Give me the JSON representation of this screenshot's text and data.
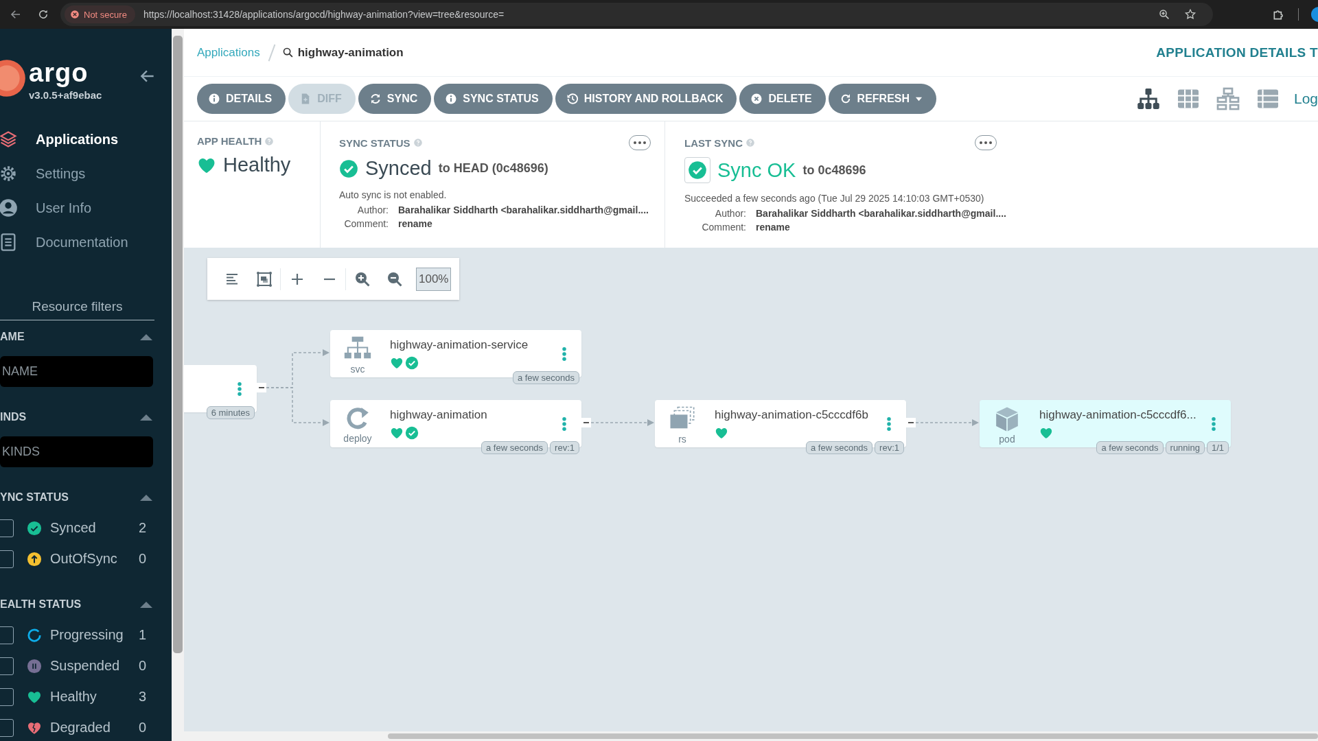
{
  "browser": {
    "security": "Not secure",
    "url": "https://localhost:31428/applications/argocd/highway-animation?view=tree&resource="
  },
  "sidebar": {
    "logo": "argo",
    "version": "v3.0.5+af9ebac",
    "nav": [
      {
        "label": "Applications",
        "kind": "layers",
        "selected": true
      },
      {
        "label": "Settings",
        "kind": "gear",
        "selected": false
      },
      {
        "label": "User Info",
        "kind": "user",
        "selected": false
      },
      {
        "label": "Documentation",
        "kind": "doc",
        "selected": false
      }
    ],
    "filters_title": "Resource filters",
    "filters": [
      {
        "kind": "input",
        "title": "AME",
        "placeholder": "NAME"
      },
      {
        "kind": "input",
        "title": "INDS",
        "placeholder": "KINDS"
      },
      {
        "kind": "checklist",
        "title": "YNC STATUS",
        "items": [
          {
            "label": "Synced",
            "count": "2",
            "kind": "synced",
            "checked": false
          },
          {
            "label": "OutOfSync",
            "count": "0",
            "kind": "outofsync",
            "checked": false
          }
        ]
      },
      {
        "kind": "checklist",
        "title": "EALTH STATUS",
        "items": [
          {
            "label": "Progressing",
            "count": "1",
            "kind": "progressing",
            "checked": false
          },
          {
            "label": "Suspended",
            "count": "0",
            "kind": "suspended",
            "checked": false
          },
          {
            "label": "Healthy",
            "count": "3",
            "kind": "healthy",
            "checked": false
          },
          {
            "label": "Degraded",
            "count": "0",
            "kind": "degraded",
            "checked": false
          }
        ]
      }
    ]
  },
  "breadcrumb": {
    "parent": "Applications",
    "current": "highway-animation"
  },
  "page_title": "APPLICATION DETAILS T",
  "actions": [
    {
      "label": "DETAILS",
      "kind": "info",
      "disabled": false,
      "dropdown": false
    },
    {
      "label": "DIFF",
      "kind": "file",
      "disabled": true,
      "dropdown": false
    },
    {
      "label": "SYNC",
      "kind": "sync",
      "disabled": false,
      "dropdown": false
    },
    {
      "label": "SYNC STATUS",
      "kind": "info",
      "disabled": false,
      "dropdown": false
    },
    {
      "label": "HISTORY AND ROLLBACK",
      "kind": "history",
      "disabled": false,
      "dropdown": false
    },
    {
      "label": "DELETE",
      "kind": "cancel",
      "disabled": false,
      "dropdown": false
    },
    {
      "label": "REFRESH",
      "kind": "refresh",
      "disabled": false,
      "dropdown": true
    }
  ],
  "views": [
    {
      "kind": "tree",
      "selected": true
    },
    {
      "kind": "grid",
      "selected": false
    },
    {
      "kind": "network",
      "selected": false
    },
    {
      "kind": "list",
      "selected": false
    }
  ],
  "log_link": "Log",
  "status": [
    {
      "kind": "health",
      "title": "APP HEALTH",
      "status": "Healthy"
    },
    {
      "kind": "sync",
      "title": "SYNC STATUS",
      "status": "Synced",
      "target": "to HEAD (0c48696)",
      "note": "Auto sync is not enabled.",
      "details": [
        {
          "label": "Author:",
          "value": "Barahalikar Siddharth <barahalikar.siddharth@gmail...."
        },
        {
          "label": "Comment:",
          "value": "rename"
        }
      ]
    },
    {
      "kind": "operation",
      "title": "LAST SYNC",
      "status": "Sync OK",
      "target": "to 0c48696",
      "note": "Succeeded a few seconds ago (Tue Jul 29 2025 14:10:03 GMT+0530)",
      "details": [
        {
          "label": "Author:",
          "value": "Barahalikar Siddharth <barahalikar.siddharth@gmail...."
        },
        {
          "label": "Comment:",
          "value": "rename"
        }
      ]
    }
  ],
  "graph": {
    "zoom": "100%",
    "root": {
      "selected": false,
      "tags": [
        "6 minutes"
      ],
      "children": [
        {
          "kind": "service",
          "name": "highway-animation-service",
          "type_label": "svc",
          "healthy": true,
          "synced": true,
          "selected": false,
          "tags": [
            "a few seconds"
          ]
        },
        {
          "kind": "deployment",
          "name": "highway-animation",
          "type_label": "deploy",
          "healthy": true,
          "synced": true,
          "selected": false,
          "tags": [
            "a few seconds",
            "rev:1"
          ],
          "children": [
            {
              "kind": "replicaset",
              "name": "highway-animation-c5cccdf6b",
              "type_label": "rs",
              "healthy": true,
              "selected": false,
              "tags": [
                "a few seconds",
                "rev:1"
              ],
              "children": [
                {
                  "kind": "pod",
                  "name": "highway-animation-c5cccdf6...",
                  "type_label": "pod",
                  "healthy": true,
                  "selected": true,
                  "tags": [
                    "a few seconds",
                    "running",
                    "1/1"
                  ]
                }
              ]
            }
          ]
        }
      ]
    }
  }
}
